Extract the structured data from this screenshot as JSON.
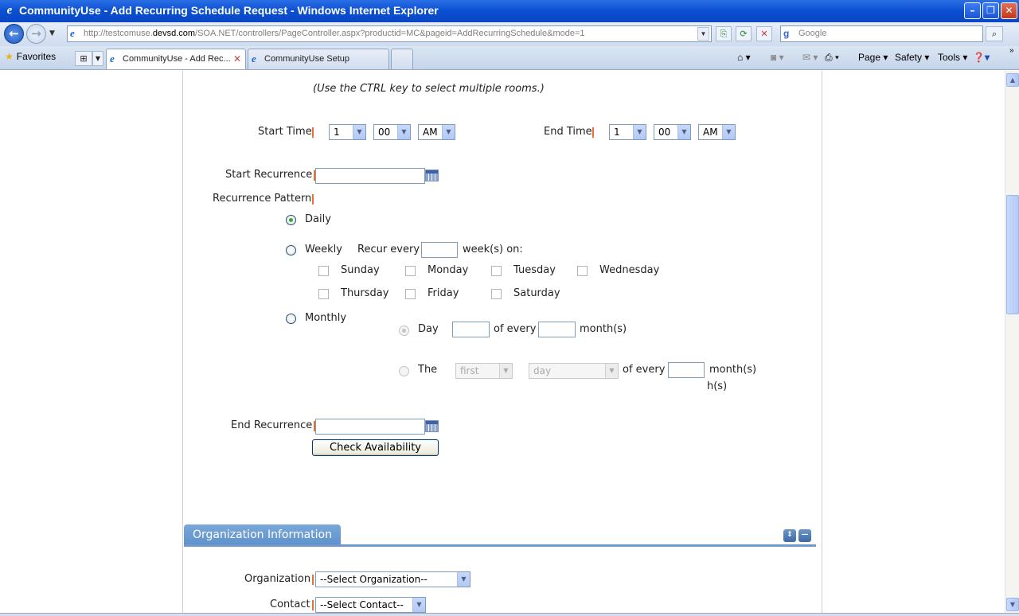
{
  "window": {
    "title": "CommunityUse - Add Recurring Schedule Request - Windows Internet Explorer",
    "minimize": "–",
    "maximize": "❐",
    "close": "✕"
  },
  "address_bar": {
    "url_prefix": "http://testcomuse.",
    "url_host": "devsd.com",
    "url_rest": "/SOA.NET/controllers/PageController.aspx?productid=MC&pageid=AddRecurringSchedule&mode=1",
    "search_placeholder": "Google"
  },
  "toolbar": {
    "favorites_label": "Favorites",
    "tabs": [
      {
        "label": "CommunityUse - Add Rec...",
        "active": true
      },
      {
        "label": "CommunityUse Setup",
        "active": false
      }
    ],
    "page_menu": "Page",
    "safety_menu": "Safety",
    "tools_menu": "Tools"
  },
  "form": {
    "rooms_hint": "(Use the CTRL key to select multiple rooms.)",
    "start_time_label": "Start Time",
    "start_hour": "1",
    "start_minute": "00",
    "start_ampm": "AM",
    "end_time_label": "End Time",
    "end_hour": "1",
    "end_minute": "00",
    "end_ampm": "AM",
    "start_recurrence_label": "Start Recurrence",
    "start_recurrence_value": "",
    "recurrence_pattern_label": "Recurrence Pattern",
    "daily_label": "Daily",
    "weekly_label": "Weekly",
    "recur_every_label": "Recur every",
    "weeks_on_label": "week(s) on:",
    "days": [
      "Sunday",
      "Monday",
      "Tuesday",
      "Wednesday",
      "Thursday",
      "Friday",
      "Saturday"
    ],
    "monthly_label": "Monthly",
    "day_label": "Day",
    "of_every_label": "of every",
    "months_label": "month(s)",
    "the_label": "The",
    "ordinal_value": "first",
    "day_type_value": "day",
    "of_every_label_2": "of every",
    "months_label_2": "month(s)",
    "months_overflow": "h(s)",
    "end_recurrence_label": "End Recurrence",
    "end_recurrence_value": "",
    "check_availability": "Check Availability"
  },
  "organization": {
    "section_title": "Organization Information",
    "organization_label": "Organization",
    "organization_value": "--Select Organization--",
    "contact_label": "Contact",
    "contact_value": "--Select Contact--"
  },
  "colors": {
    "required_marker": "#e8712f",
    "section_header": "#6f9ad0",
    "titlebar": "#0a4fd2"
  }
}
